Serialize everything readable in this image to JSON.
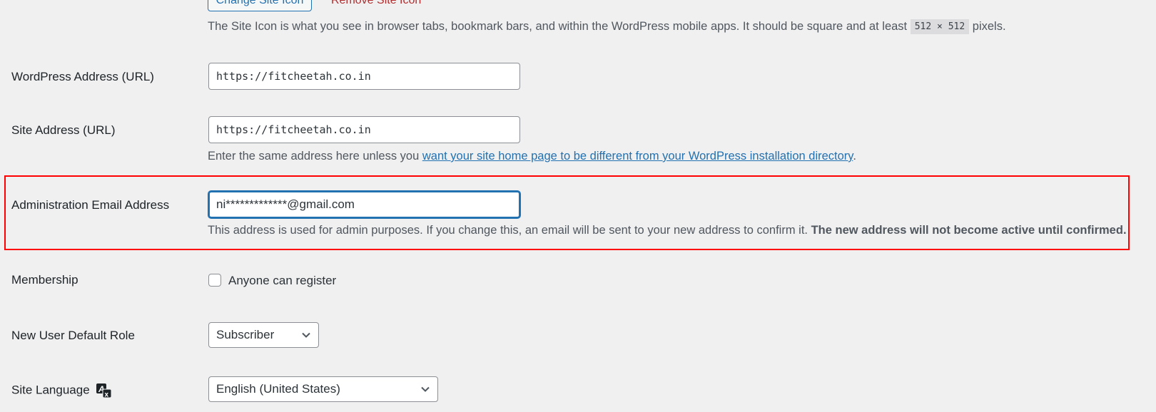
{
  "site_icon": {
    "change_button": "Change Site Icon",
    "remove_link": "Remove Site Icon",
    "description_before": "The Site Icon is what you see in browser tabs, bookmark bars, and within the WordPress mobile apps. It should be square and at least",
    "size_code": "512 × 512",
    "description_after": "pixels."
  },
  "wordpress_address": {
    "label": "WordPress Address (URL)",
    "value": "https://fitcheetah.co.in"
  },
  "site_address": {
    "label": "Site Address (URL)",
    "value": "https://fitcheetah.co.in",
    "description_before": "Enter the same address here unless you",
    "description_link": "want your site home page to be different from your WordPress installation directory",
    "description_after": "."
  },
  "admin_email": {
    "label": "Administration Email Address",
    "value": "ni*************@gmail.com",
    "description": "This address is used for admin purposes. If you change this, an email will be sent to your new address to confirm it.",
    "description_bold": "The new address will not become active until confirmed.",
    "highlight_color": "#ff0000"
  },
  "membership": {
    "label": "Membership",
    "checkbox_label": "Anyone can register",
    "checked": false
  },
  "default_role": {
    "label": "New User Default Role",
    "selected": "Subscriber"
  },
  "site_language": {
    "label": "Site Language",
    "icon": "translation-icon",
    "selected": "English (United States)"
  },
  "colors": {
    "accent": "#2271b1",
    "danger": "#b32d2e",
    "background": "#f0f0f1"
  }
}
